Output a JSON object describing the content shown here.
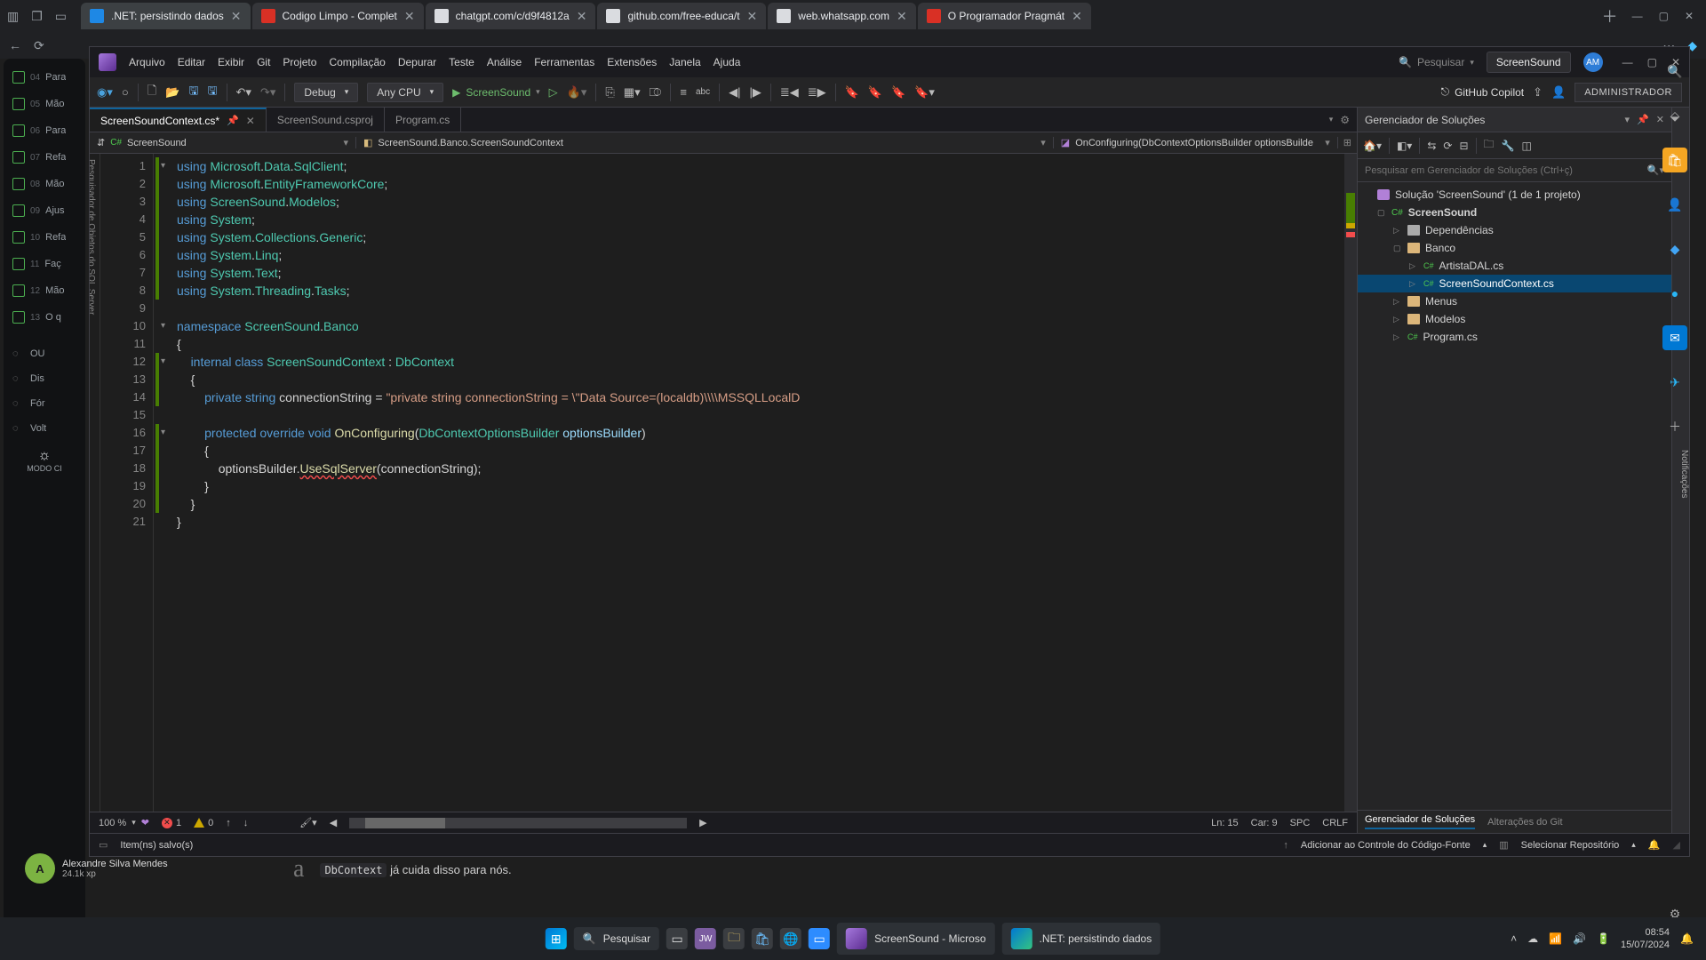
{
  "browser": {
    "tabs": [
      {
        "label": ".NET: persistindo dados",
        "fav": "#1e88e5",
        "active": true
      },
      {
        "label": "Codigo Limpo - Complet",
        "fav": "#d93025"
      },
      {
        "label": "chatgpt.com/c/d9f4812a",
        "fav": "#dadce0"
      },
      {
        "label": "github.com/free-educa/t",
        "fav": "#dadce0"
      },
      {
        "label": "web.whatsapp.com",
        "fav": "#dadce0"
      },
      {
        "label": "O Programador Pragmát",
        "fav": "#d93025"
      }
    ]
  },
  "leftrail": {
    "items": [
      {
        "n": "04",
        "t": "Para"
      },
      {
        "n": "05",
        "t": "Mão"
      },
      {
        "n": "06",
        "t": "Para"
      },
      {
        "n": "07",
        "t": "Refa"
      },
      {
        "n": "08",
        "t": "Mão"
      },
      {
        "n": "09",
        "t": "Ajus"
      },
      {
        "n": "10",
        "t": "Refa"
      },
      {
        "n": "11",
        "t": "Faç"
      },
      {
        "n": "12",
        "t": "Mão"
      },
      {
        "n": "13",
        "t": "O q"
      }
    ],
    "extra": [
      "OU",
      "Dis",
      "Fór",
      "Volt"
    ],
    "modo": "MODO CI"
  },
  "vs": {
    "menu": [
      "Arquivo",
      "Editar",
      "Exibir",
      "Git",
      "Projeto",
      "Compilação",
      "Depurar",
      "Teste",
      "Análise",
      "Ferramentas",
      "Extensões",
      "Janela",
      "Ajuda"
    ],
    "search_placeholder": "Pesquisar",
    "solution_pill": "ScreenSound",
    "avatar": "AM",
    "toolbar": {
      "debug": "Debug",
      "anycpu": "Any CPU",
      "run": "ScreenSound",
      "copilot": "GitHub Copilot",
      "admin": "ADMINISTRADOR"
    },
    "doc_tabs": [
      {
        "label": "ScreenSoundContext.cs*",
        "active": true
      },
      {
        "label": "ScreenSound.csproj"
      },
      {
        "label": "Program.cs"
      }
    ],
    "navbar2": {
      "proj": "ScreenSound",
      "ns": "ScreenSound.Banco.ScreenSoundContext",
      "member": "OnConfiguring(DbContextOptionsBuilder optionsBuilde"
    },
    "editor_status": {
      "zoom": "100 %",
      "errors": "1",
      "warnings": "0",
      "ln": "Ln: 15",
      "car": "Car: 9",
      "spc": "SPC",
      "crlf": "CRLF"
    },
    "side_rail_label": "Pesquisador de Objetos do SQL Server",
    "right_rail_label": "Notificações",
    "code": {
      "1": [
        [
          "kw",
          "using "
        ],
        [
          "cls",
          "Microsoft"
        ],
        [
          "pun",
          "."
        ],
        [
          "cls",
          "Data"
        ],
        [
          "pun",
          "."
        ],
        [
          "cls",
          "SqlClient"
        ],
        [
          "pun",
          ";"
        ]
      ],
      "2": [
        [
          "kw",
          "using "
        ],
        [
          "cls",
          "Microsoft"
        ],
        [
          "pun",
          "."
        ],
        [
          "cls",
          "EntityFrameworkCore"
        ],
        [
          "pun",
          ";"
        ]
      ],
      "3": [
        [
          "kw",
          "using "
        ],
        [
          "cls",
          "ScreenSound"
        ],
        [
          "pun",
          "."
        ],
        [
          "cls",
          "Modelos"
        ],
        [
          "pun",
          ";"
        ]
      ],
      "4": [
        [
          "kw",
          "using "
        ],
        [
          "cls",
          "System"
        ],
        [
          "pun",
          ";"
        ]
      ],
      "5": [
        [
          "kw",
          "using "
        ],
        [
          "cls",
          "System"
        ],
        [
          "pun",
          "."
        ],
        [
          "cls",
          "Collections"
        ],
        [
          "pun",
          "."
        ],
        [
          "cls",
          "Generic"
        ],
        [
          "pun",
          ";"
        ]
      ],
      "6": [
        [
          "kw",
          "using "
        ],
        [
          "cls",
          "System"
        ],
        [
          "pun",
          "."
        ],
        [
          "cls",
          "Linq"
        ],
        [
          "pun",
          ";"
        ]
      ],
      "7": [
        [
          "kw",
          "using "
        ],
        [
          "cls",
          "System"
        ],
        [
          "pun",
          "."
        ],
        [
          "cls",
          "Text"
        ],
        [
          "pun",
          ";"
        ]
      ],
      "8": [
        [
          "kw",
          "using "
        ],
        [
          "cls",
          "System"
        ],
        [
          "pun",
          "."
        ],
        [
          "cls",
          "Threading"
        ],
        [
          "pun",
          "."
        ],
        [
          "cls",
          "Tasks"
        ],
        [
          "pun",
          ";"
        ]
      ],
      "9": [
        [
          "pln",
          ""
        ]
      ],
      "10": [
        [
          "kw",
          "namespace "
        ],
        [
          "cls",
          "ScreenSound"
        ],
        [
          "pun",
          "."
        ],
        [
          "cls",
          "Banco"
        ]
      ],
      "11": [
        [
          "pun",
          "{"
        ]
      ],
      "12": [
        [
          "pln",
          "    "
        ],
        [
          "kw",
          "internal class "
        ],
        [
          "cls",
          "ScreenSoundContext"
        ],
        [
          "pln",
          " "
        ],
        [
          "pun",
          ":"
        ],
        [
          "pln",
          " "
        ],
        [
          "cls",
          "DbContext"
        ]
      ],
      "13": [
        [
          "pln",
          "    "
        ],
        [
          "pun",
          "{"
        ]
      ],
      "14": [
        [
          "pln",
          "        "
        ],
        [
          "kw",
          "private "
        ],
        [
          "kw",
          "string "
        ],
        [
          "pln",
          "connectionString "
        ],
        [
          "pun",
          "="
        ],
        [
          "pln",
          " "
        ],
        [
          "str",
          "\"private string connectionString = \\\"Data Source=(localdb)\\\\\\\\MSSQLLocalD"
        ]
      ],
      "15": [
        [
          "pln",
          "        "
        ]
      ],
      "16": [
        [
          "pln",
          "        "
        ],
        [
          "kw",
          "protected override void "
        ],
        [
          "mth",
          "OnConfiguring"
        ],
        [
          "pun",
          "("
        ],
        [
          "cls",
          "DbContextOptionsBuilder"
        ],
        [
          "pln",
          " "
        ],
        [
          "param",
          "optionsBuilder"
        ],
        [
          "pun",
          ")"
        ]
      ],
      "17": [
        [
          "pln",
          "        "
        ],
        [
          "pun",
          "{"
        ]
      ],
      "18": [
        [
          "pln",
          "            "
        ],
        [
          "pln",
          "optionsBuilder"
        ],
        [
          "pun",
          "."
        ],
        [
          "mth squiggle",
          "UseSqlServer"
        ],
        [
          "pun",
          "("
        ],
        [
          "pln",
          "connectionString"
        ],
        [
          "pun",
          ");"
        ]
      ],
      "19": [
        [
          "pln",
          "        "
        ],
        [
          "pun",
          "}"
        ]
      ],
      "20": [
        [
          "pln",
          "    "
        ],
        [
          "pun",
          "}"
        ]
      ],
      "21": [
        [
          "pun",
          "}"
        ]
      ]
    },
    "status_bar": {
      "saved": "Item(ns) salvo(s)",
      "add_source": "Adicionar ao Controle do Código-Fonte",
      "select_repo": "Selecionar Repositório"
    }
  },
  "soln": {
    "title": "Gerenciador de Soluções",
    "search_placeholder": "Pesquisar em Gerenciador de Soluções (Ctrl+ç)",
    "nodes": {
      "root": "Solução 'ScreenSound' (1 de 1 projeto)",
      "proj": "ScreenSound",
      "dep": "Dependências",
      "banco": "Banco",
      "artista": "ArtistaDAL.cs",
      "ctx": "ScreenSoundContext.cs",
      "menus": "Menus",
      "modelos": "Modelos",
      "program": "Program.cs"
    },
    "foot": {
      "t1": "Gerenciador de Soluções",
      "t2": "Alterações do Git"
    }
  },
  "alura": {
    "user_initial": "A",
    "user_name": "Alexandre Silva Mendes",
    "user_xp": "24.1k xp",
    "text": "  já cuida disso para nós.",
    "code": "DbContext"
  },
  "taskbar": {
    "search": "Pesquisar",
    "apps": {
      "vs": "ScreenSound - Microso",
      "edge": ".NET: persistindo dados"
    },
    "clock": {
      "time": "08:54",
      "date": "15/07/2024"
    }
  }
}
